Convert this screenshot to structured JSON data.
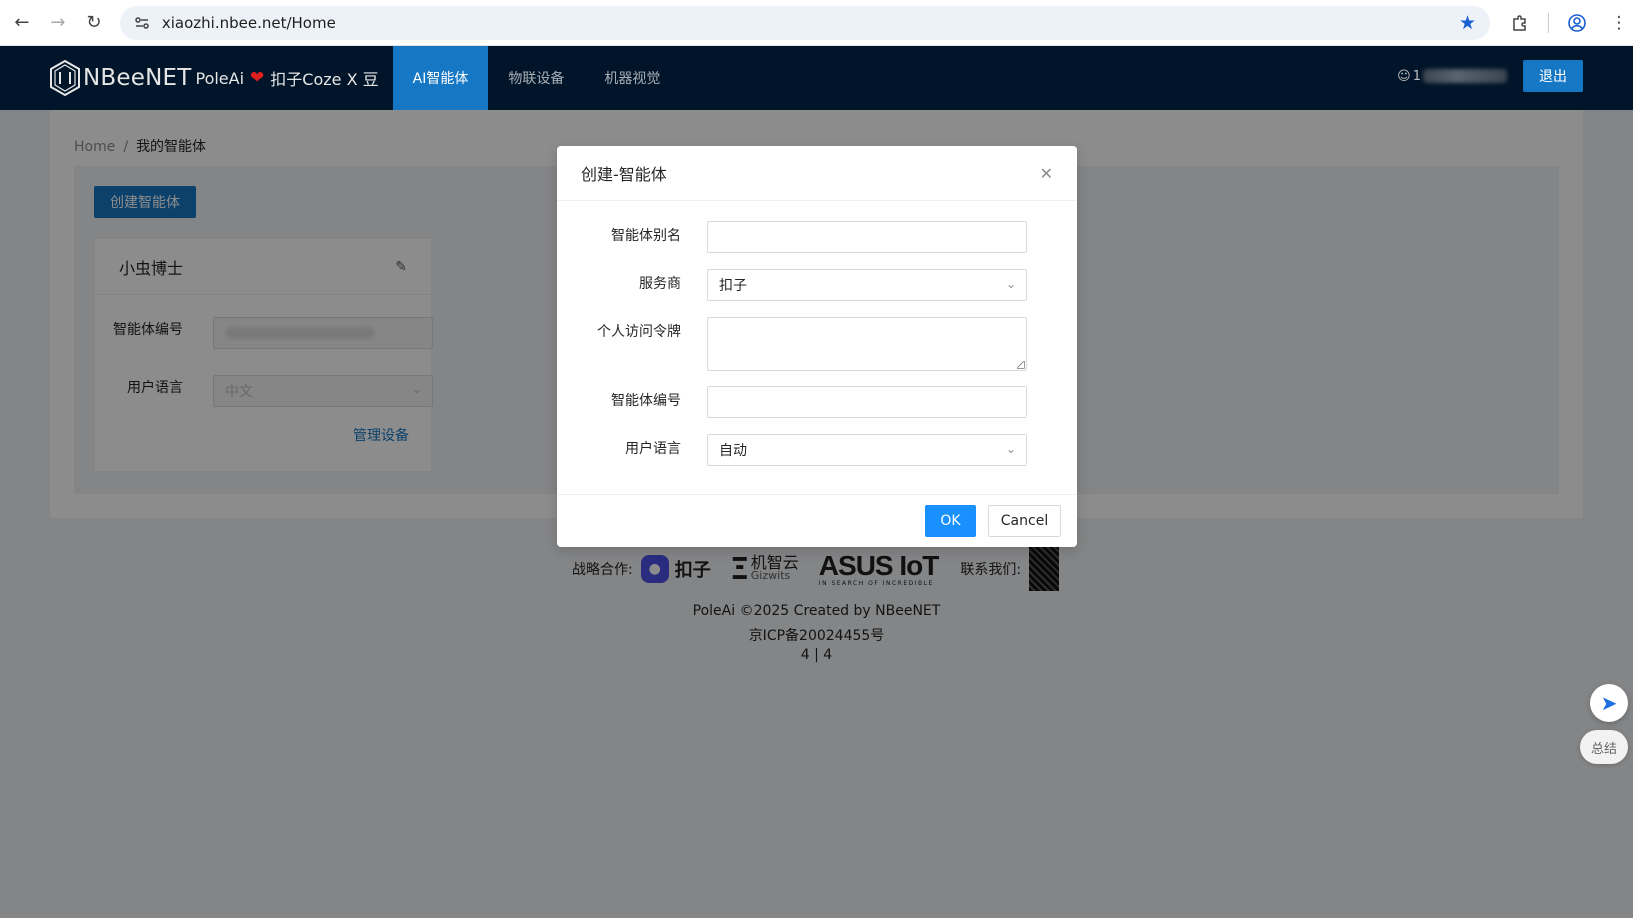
{
  "browser": {
    "url": "xiaozhi.nbee.net/Home"
  },
  "app": {
    "brand": "NBeeNET",
    "sub": "PoleAi",
    "partner": "扣子Coze X 豆",
    "menu": [
      {
        "label": "AI智能体",
        "active": true
      },
      {
        "label": "物联设备",
        "active": false
      },
      {
        "label": "机器视觉",
        "active": false
      }
    ],
    "user_prefix": "1",
    "logout_label": "退出"
  },
  "breadcrumb": {
    "home": "Home",
    "separator": "/",
    "current": "我的智能体"
  },
  "toolbar": {
    "create_label": "创建智能体"
  },
  "agent_card": {
    "title": "小虫博士",
    "id_label": "智能体编号",
    "lang_label": "用户语言",
    "lang_value": "中文",
    "manage_label": "管理设备"
  },
  "footer": {
    "partners_label": "战略合作:",
    "coze_text": "扣子",
    "gizwits_cn": "机智云",
    "gizwits_en": "Gizwits",
    "asus_main": "ASUS IoT",
    "asus_tag": "IN SEARCH OF INCREDIBLE",
    "contact_label": "联系我们:",
    "copyright": "PoleAi ©2025 Created by NBeeNET",
    "icp": "京ICP备20024455号",
    "pager": "4 | 4"
  },
  "modal": {
    "title": "创建-智能体",
    "fields": {
      "alias_label": "智能体别名",
      "alias_value": "",
      "provider_label": "服务商",
      "provider_value": "扣子",
      "token_label": "个人访问令牌",
      "token_value": "",
      "agent_id_label": "智能体编号",
      "agent_id_value": "",
      "lang_label": "用户语言",
      "lang_value": "自动"
    },
    "ok_label": "OK",
    "cancel_label": "Cancel"
  },
  "widget": {
    "summary_label": "总结"
  },
  "colors": {
    "header_bg": "#001529",
    "primary": "#1677c4",
    "ok_button": "#1890ff",
    "heart": "#e02020"
  }
}
